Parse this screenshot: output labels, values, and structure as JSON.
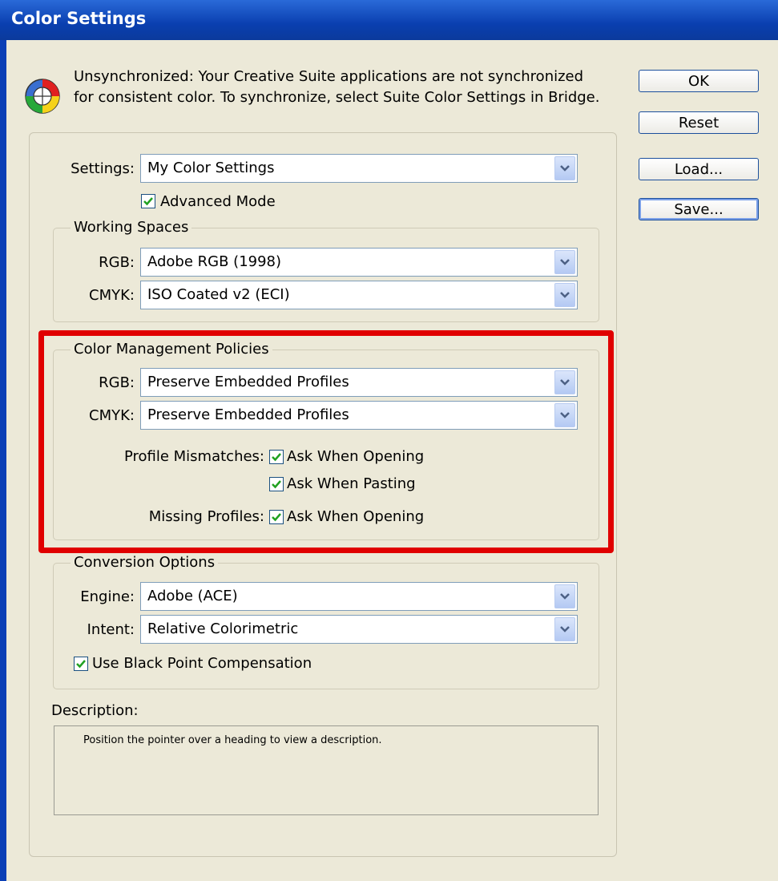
{
  "window": {
    "title": "Color Settings"
  },
  "message": "Unsynchronized: Your Creative Suite applications are not synchronized\nfor consistent color. To synchronize, select Suite Color Settings in Bridge.",
  "buttons": {
    "ok": "OK",
    "reset": "Reset",
    "load": "Load...",
    "save": "Save..."
  },
  "settings": {
    "label": "Settings:",
    "value": "My Color Settings",
    "advanced_mode": "Advanced Mode",
    "advanced_checked": true
  },
  "working_spaces": {
    "legend": "Working Spaces",
    "rgb_label": "RGB:",
    "rgb_value": "Adobe RGB (1998)",
    "cmyk_label": "CMYK:",
    "cmyk_value": "ISO Coated v2 (ECI)"
  },
  "policies": {
    "legend": "Color Management Policies",
    "rgb_label": "RGB:",
    "rgb_value": "Preserve Embedded Profiles",
    "cmyk_label": "CMYK:",
    "cmyk_value": "Preserve Embedded Profiles",
    "mismatch_label": "Profile Mismatches:",
    "ask_opening": "Ask When Opening",
    "ask_pasting": "Ask When Pasting",
    "missing_label": "Missing Profiles:",
    "missing_ask_opening": "Ask When Opening"
  },
  "conversion": {
    "legend": "Conversion Options",
    "engine_label": "Engine:",
    "engine_value": "Adobe (ACE)",
    "intent_label": "Intent:",
    "intent_value": "Relative Colorimetric",
    "bpc": "Use Black Point Compensation"
  },
  "description": {
    "label": "Description:",
    "text": "Position the pointer over a heading to view a description."
  },
  "colors": {
    "highlight": "#e00000",
    "titlebar": "#0a3fb0"
  }
}
